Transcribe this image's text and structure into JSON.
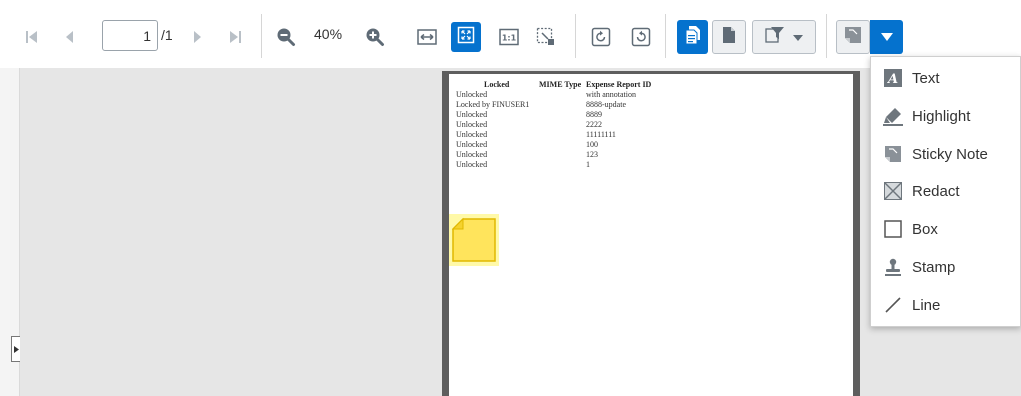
{
  "colors": {
    "accent": "#0572ce",
    "icon": "#5f6b76",
    "icon_disabled": "#b9c0c7",
    "viewer_bg": "#e6e6e6",
    "sticky_note": "#ffe45c"
  },
  "toolbar": {
    "nav_icons": [
      "first-page-icon",
      "previous-page-icon",
      "next-page-icon",
      "last-page-icon"
    ],
    "page_number": "1",
    "page_total": "/1",
    "zoom_level": "40%",
    "zoom_icons": [
      "zoom-out-icon",
      "zoom-in-icon"
    ],
    "fit_icons": [
      "fit-width-icon",
      "fit-page-icon",
      "actual-size-icon",
      "marquee-zoom-icon"
    ],
    "rotate_icons": [
      "rotate-left-icon",
      "rotate-right-icon"
    ],
    "view_icons": [
      "document-view-icon",
      "page-view-icon",
      "filter-icon"
    ],
    "annotation_icons": [
      "sticky-note-tool-icon",
      "dropdown-caret-icon"
    ]
  },
  "document": {
    "headers": [
      "Locked",
      "MIME Type",
      "Expense Report ID"
    ],
    "rows": [
      {
        "locked": "Unlocked",
        "report": "with annotation"
      },
      {
        "locked": "Locked by FINUSER1",
        "report": "8888-update"
      },
      {
        "locked": "Unlocked",
        "report": "8889"
      },
      {
        "locked": "Unlocked",
        "report": "2222"
      },
      {
        "locked": "Unlocked",
        "report": "11111111"
      },
      {
        "locked": "Unlocked",
        "report": "100"
      },
      {
        "locked": "Unlocked",
        "report": "123"
      },
      {
        "locked": "Unlocked",
        "report": "1"
      }
    ]
  },
  "annotation_menu": {
    "items": [
      {
        "label": "Text",
        "icon": "text-annotation-icon"
      },
      {
        "label": "Highlight",
        "icon": "highlight-icon"
      },
      {
        "label": "Sticky Note",
        "icon": "sticky-note-icon"
      },
      {
        "label": "Redact",
        "icon": "redact-icon"
      },
      {
        "label": "Box",
        "icon": "box-icon"
      },
      {
        "label": "Stamp",
        "icon": "stamp-icon"
      },
      {
        "label": "Line",
        "icon": "line-icon"
      }
    ]
  }
}
